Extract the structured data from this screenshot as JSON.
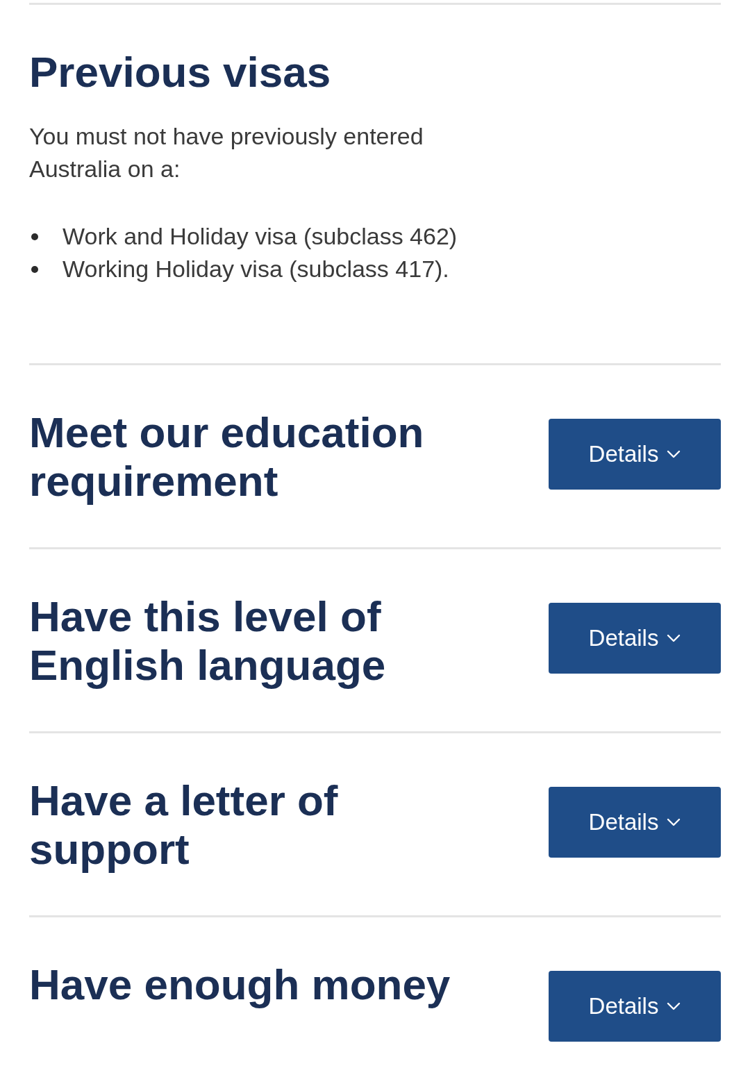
{
  "previous_visas": {
    "heading": "Previous visas",
    "intro": "You must not have previously entered Australia on a:",
    "visas": [
      "Work and Holiday visa (subclass 462)",
      "Working Holiday visa (subclass 417)."
    ]
  },
  "requirements": [
    {
      "heading": "Meet our education requirement",
      "button": "Details",
      "expanded": false
    },
    {
      "heading": "Have this level of English language",
      "button": "Details",
      "expanded": false
    },
    {
      "heading": "Have a letter of support",
      "button": "Details",
      "expanded": false
    },
    {
      "heading": "Have enough money",
      "button": "Details",
      "expanded": false
    }
  ]
}
